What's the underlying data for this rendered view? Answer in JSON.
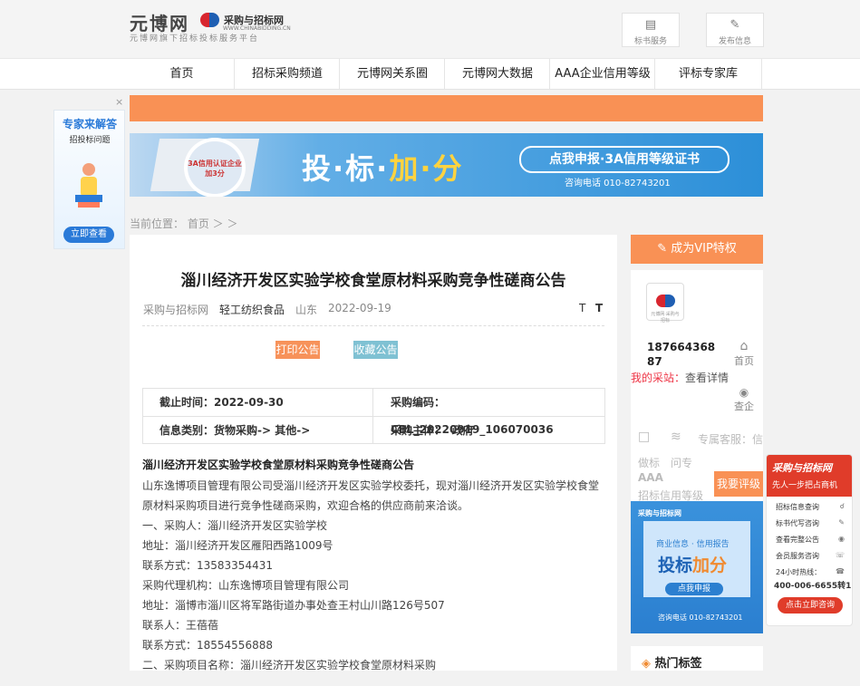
{
  "header": {
    "logo_main": "元博网",
    "logo_sub": "元博网旗下招标投标服务平台",
    "logo2_text": "采购与招标网",
    "logo2_url": "WWW.CHINABIDDING.CN",
    "btn_bid_service": "标书服务",
    "btn_publish": "发布信息"
  },
  "nav": {
    "items": [
      "首页",
      "招标采购频道",
      "元博网关系圈",
      "元博网大数据",
      "AAA企业信用等级",
      "评标专家库"
    ]
  },
  "ad_banner": {
    "badge": "3A信用认证企业 加3分",
    "title_1": "投·标·",
    "title_2": "加·分",
    "pill": "点我申报·3A信用等级证书",
    "phone": "咨询电话  010-82743201"
  },
  "left_ad": {
    "title": "专家来解答",
    "sub": "招投标问题",
    "button": "立即查看",
    "close": "×"
  },
  "breadcrumb": "当前位置： 首页 ＞ ＞",
  "article": {
    "title": "淄川经济开发区实验学校食堂原材料采购竞争性磋商公告",
    "meta_source": "采购与招标网",
    "meta_category": "轻工纺织食品",
    "meta_region": "山东",
    "meta_date": "2022-09-19",
    "font_small": "T",
    "font_large": "T",
    "btn_print": "打印公告",
    "btn_fav": "收藏公告",
    "info": {
      "deadline": "截止时间：2022-09-30",
      "code": "采购编码：CBL_20220919_106070036",
      "type": "信息类别：货物采购-> 其他->",
      "subject_label": "采购主体：",
      "subject_value": "政府"
    },
    "body_title": "淄川经济开发区实验学校食堂原材料采购竞争性磋商公告",
    "body_lines": [
      "山东逸博项目管理有限公司受淄川经济开发区实验学校委托，现对淄川经济开发区实验学校食堂",
      "原材料采购项目进行竞争性磋商采购，欢迎合格的供应商前来洽谈。",
      "一、采购人：淄川经济开发区实验学校",
      "地址：淄川经济开发区雁阳西路1009号",
      "联系方式：13583354431",
      "采购代理机构：山东逸博项目管理有限公司",
      "地址：淄博市淄川区将军路街道办事处查王村山川路126号507",
      "联系人：王蓓蓓",
      "联系方式：18554556888",
      "二、采购项目名称：淄川经济开发区实验学校食堂原材料采购"
    ]
  },
  "sidebar": {
    "vip": "成为VIP特权",
    "company_logo_text": "元博网·采购与招标",
    "phone": "18766436887",
    "home": "首页",
    "my_collect_prefix": "我的采",
    "my_collect_mid": "站：",
    "my_collect_link": "查看详情",
    "check": "查企",
    "exclusive": "专属客服：信",
    "bid_write": "做标",
    "ask": "问专",
    "aaa": "AAA",
    "aaa_sub": "招标信用等级",
    "rate_btn": "我要评级",
    "hot_tags": "热门标签"
  },
  "right_ad": {
    "logo": "采购与招标网",
    "t1": "商业信息 · 信用报告",
    "t2a": "投标",
    "t2b": "加分",
    "btn": "点我申报",
    "phone": "咨询电话  010-82743201"
  },
  "float_widget": {
    "title": "采购与招标网",
    "sub": "先人一步把占商机",
    "items": [
      "招标信息查询",
      "标书代写咨询",
      "查看完整公告",
      "会员服务咨询",
      "24小时热线："
    ],
    "hotline": "400-006-6655转1",
    "button": "点击立即咨询"
  }
}
